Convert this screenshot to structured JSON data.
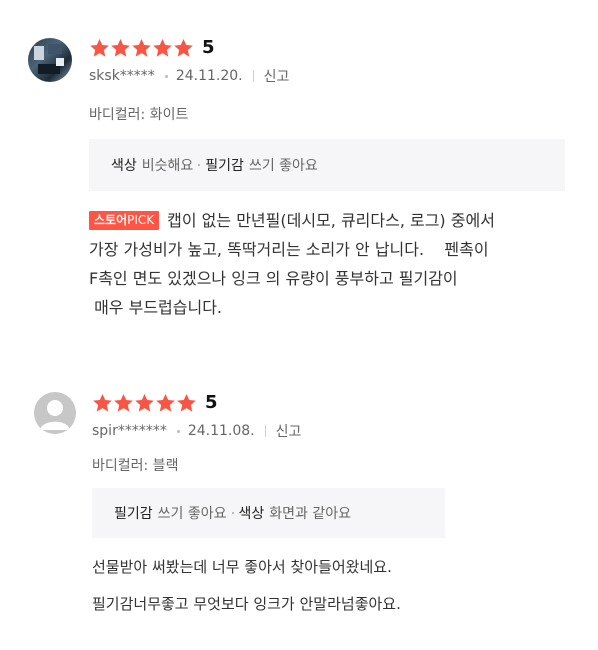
{
  "colors": {
    "star": "#f95545",
    "badge": "#ff5544",
    "tag_bg": "#f6f6f8"
  },
  "reviews": [
    {
      "avatar": "user-photo",
      "rating": 5,
      "score_label": "5",
      "username": "sksk*****",
      "date": "24.11.20.",
      "report_label": "신고",
      "option": "바디컬러: 화이트",
      "tags": [
        {
          "name": "색상",
          "value": "비슷해요"
        },
        {
          "name": "필기감",
          "value": "쓰기 좋아요"
        }
      ],
      "badge": {
        "bold": "스토어",
        "light": "PICK"
      },
      "lines": [
        "캡이 없는 만년필(데시모, 큐리다스, 로그) 중에서",
        "가장 가성비가 높고, 똑딱거리는 소리가 안 납니다.    펜촉이",
        "F촉인 면도 있겠으나 잉크 의 유량이 풍부하고 필기감이",
        " 매우 부드럽습니다."
      ]
    },
    {
      "avatar": "default-user",
      "rating": 5,
      "score_label": "5",
      "username": "spir*******",
      "date": "24.11.08.",
      "report_label": "신고",
      "option": "바디컬러: 블랙",
      "tags": [
        {
          "name": "필기감",
          "value": "쓰기 좋아요"
        },
        {
          "name": "색상",
          "value": "화면과 같아요"
        }
      ],
      "lines": [
        "선물받아 써봤는데 너무 좋아서 찾아들어왔네요.",
        "필기감너무좋고 무엇보다 잉크가 안말라넘좋아요."
      ]
    }
  ]
}
